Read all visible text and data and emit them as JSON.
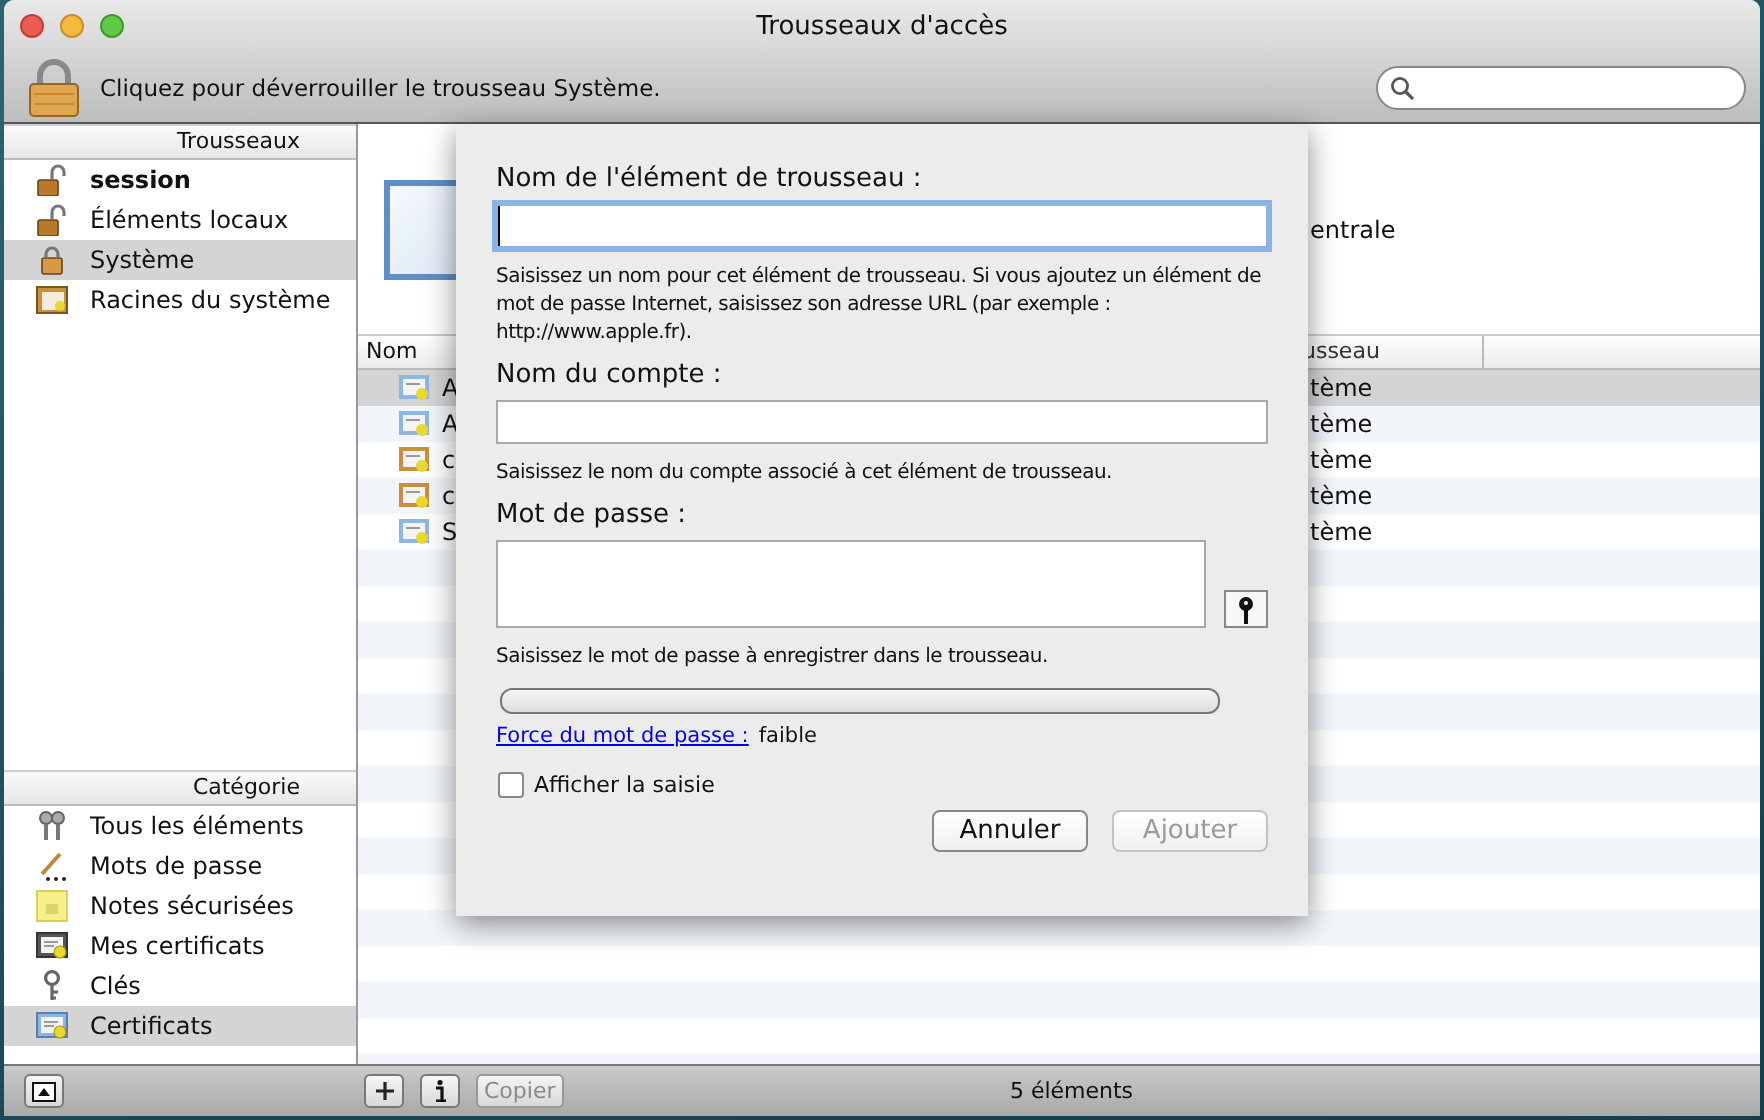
{
  "window": {
    "title": "Trousseaux d'accès"
  },
  "toolbar": {
    "lock_message": "Cliquez pour déverrouiller le trousseau Système."
  },
  "sidebar": {
    "keychains": {
      "heading": "Trousseaux",
      "items": [
        {
          "label": "session",
          "kind": "unlocked",
          "bold": true,
          "selected": false
        },
        {
          "label": "Éléments locaux",
          "kind": "unlocked",
          "bold": false,
          "selected": false
        },
        {
          "label": "Système",
          "kind": "locked",
          "bold": false,
          "selected": true
        },
        {
          "label": "Racines du système",
          "kind": "roots",
          "bold": false,
          "selected": false
        }
      ]
    },
    "categories": {
      "heading": "Catégorie",
      "items": [
        {
          "label": "Tous les éléments",
          "kind": "all",
          "selected": false
        },
        {
          "label": "Mots de passe",
          "kind": "password",
          "selected": false
        },
        {
          "label": "Notes sécurisées",
          "kind": "note",
          "selected": false
        },
        {
          "label": "Mes certificats",
          "kind": "mycert",
          "selected": false
        },
        {
          "label": "Clés",
          "kind": "key",
          "selected": false
        },
        {
          "label": "Certificats",
          "kind": "cert",
          "selected": true
        }
      ]
    }
  },
  "detail": {
    "text": "entrale"
  },
  "table": {
    "columns": [
      {
        "label": "Nom"
      },
      {
        "label": "usseau"
      }
    ],
    "rows": [
      {
        "name": "A",
        "keychain": "tème",
        "color": "#8fb6e2",
        "selected": true
      },
      {
        "name": "A",
        "keychain": "tème",
        "color": "#8fb6e2",
        "selected": false
      },
      {
        "name": "c",
        "keychain": "tème",
        "color": "#c98f3c",
        "selected": false
      },
      {
        "name": "c",
        "keychain": "tème",
        "color": "#c98f3c",
        "selected": false
      },
      {
        "name": "S",
        "keychain": "tème",
        "color": "#8fb6e2",
        "selected": false
      }
    ]
  },
  "sheet": {
    "fields": [
      {
        "label": "Nom de l'élément de trousseau :",
        "kind": "line",
        "focused": true,
        "help": "Saisissez un nom pour cet élément de trousseau. Si vous ajoutez un élément de mot de passe Internet, saisissez son adresse URL (par exemple : http://www.apple.fr)."
      },
      {
        "label": "Nom du compte :",
        "kind": "line",
        "focused": false,
        "help": "Saisissez le nom du compte associé à cet élément de trousseau."
      },
      {
        "label": "Mot de passe :",
        "kind": "password",
        "focused": false,
        "help": "Saisissez le mot de passe à enregistrer dans le trousseau."
      }
    ],
    "strength": {
      "label": "Force du mot de passe :",
      "value": "faible",
      "level": 0
    },
    "show_typing": {
      "label": "Afficher la saisie",
      "checked": false
    },
    "buttons": [
      {
        "label": "Annuler",
        "disabled": false
      },
      {
        "label": "Ajouter",
        "disabled": true
      }
    ]
  },
  "bottom_bar": {
    "copy_button": {
      "label": "Copier",
      "disabled": true
    },
    "count": "5 éléments"
  }
}
